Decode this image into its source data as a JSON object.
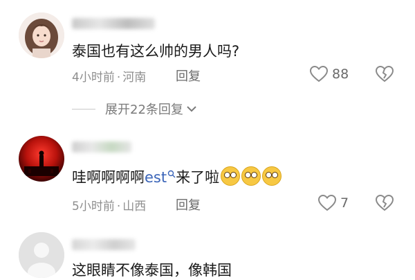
{
  "comments": [
    {
      "text": "泰国也有这么帅的男人吗?",
      "time": "4小时前",
      "location": "河南",
      "reply_label": "回复",
      "likes": "88",
      "expand_label": "展开22条回复"
    },
    {
      "text_before": "哇啊啊啊啊",
      "mention": "est",
      "text_after": "来了啦",
      "emoji_count": 3,
      "time": "5小时前",
      "location": "山西",
      "reply_label": "回复",
      "likes": "7"
    },
    {
      "text": "这眼睛不像泰国，像韩国"
    }
  ],
  "colors": {
    "meta_gray": "#8e8e8e",
    "mention_blue": "#3a64b8",
    "icon_gray": "#8a8a8a"
  }
}
